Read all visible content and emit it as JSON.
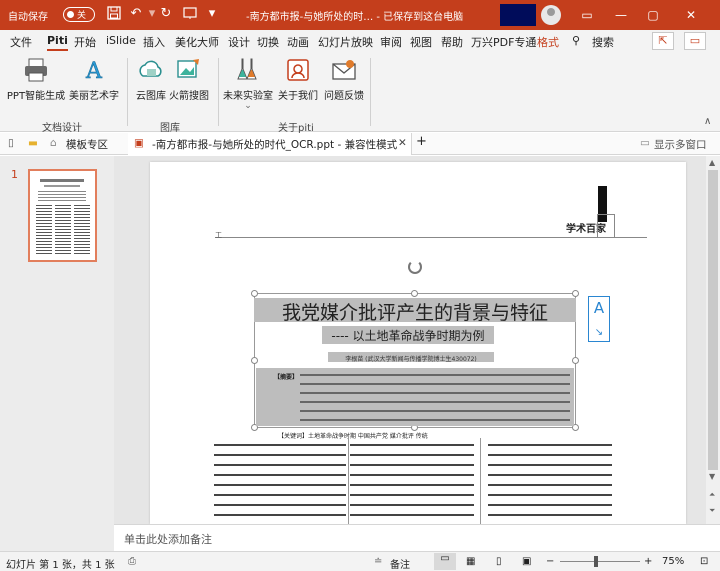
{
  "titlebar": {
    "autosave_label": "自动保存",
    "autosave_state": "关",
    "doc_title": "-南方都市报-与她所处的时…  -  已保存到这台电脑"
  },
  "menu": [
    "文件",
    "Piti",
    "开始",
    "iSlide",
    "插入",
    "美化大师",
    "设计",
    "切换",
    "动画",
    "幻灯片放映",
    "审阅",
    "视图",
    "帮助",
    "万兴PDF专通",
    "格式",
    "搜索"
  ],
  "ribbon": {
    "groups": [
      {
        "label": "文档设计",
        "items": [
          "PPT智能生成",
          "美丽艺术字"
        ]
      },
      {
        "label": "图库",
        "items": [
          "云图库",
          "火箭搜图"
        ]
      },
      {
        "label": "关于piti",
        "items": [
          "未来实验室",
          "关于我们",
          "问题反馈"
        ]
      }
    ]
  },
  "tabs": {
    "template_zone": "模板专区",
    "doc_tab": "-南方都市报-与她所处的时代_OCR.ppt  -  兼容性模式",
    "show_windows": "显示多窗口"
  },
  "thumbs": {
    "number": "1"
  },
  "slide": {
    "logo_text": "学术百家",
    "title": "我党媒介批评产生的背景与特征",
    "subtitle": "---- 以土地革命战争时期为例",
    "author": "李根苗 (武汉大学新闻与传播学院博士生430072)",
    "abstract_lead": "【摘要】",
    "keywords": "【关键词】土地革命战争时期 中国共产党 媒介批评 传统"
  },
  "notes": {
    "placeholder": "单击此处添加备注"
  },
  "status": {
    "slide_info": "幻灯片 第 1 张，共 1 张",
    "notes_btn": "备注",
    "zoom": "75%"
  }
}
